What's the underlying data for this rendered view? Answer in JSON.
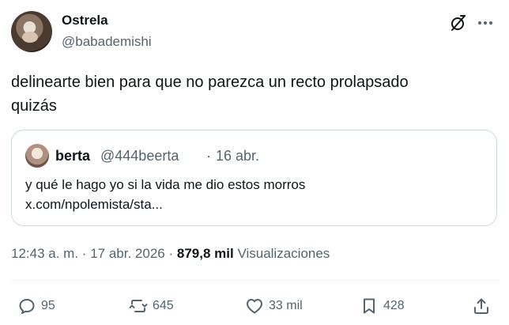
{
  "author": {
    "display_name": "Ostrela",
    "handle": "@babademishi"
  },
  "icons": {
    "grok": "grok-icon",
    "more": "more-icon",
    "reply": "reply-icon",
    "retweet": "retweet-icon",
    "like": "heart-icon",
    "bookmark": "bookmark-icon",
    "share": "share-icon"
  },
  "tweet": {
    "text_line1": "delinearte bien para que no parezca un recto prolapsado",
    "text_line2": "quizás"
  },
  "quote": {
    "display_name": "berta",
    "handle": "@444beerta",
    "separator": "·",
    "date": "16 abr.",
    "text": "y qué le hago yo si la vida me dio estos morros",
    "link": "x.com/npolemista/sta..."
  },
  "meta": {
    "time": "12:43 a. m.",
    "separator1": "·",
    "date": "17 abr. 2026",
    "separator2": "·",
    "views_count": "879,8 mil",
    "views_label": "Visualizaciones"
  },
  "actions": {
    "replies": "95",
    "reposts": "645",
    "likes": "33 mil",
    "bookmarks": "428"
  },
  "colors": {
    "text": "#0f1419",
    "secondary": "#536471",
    "border": "#cfd9de"
  }
}
